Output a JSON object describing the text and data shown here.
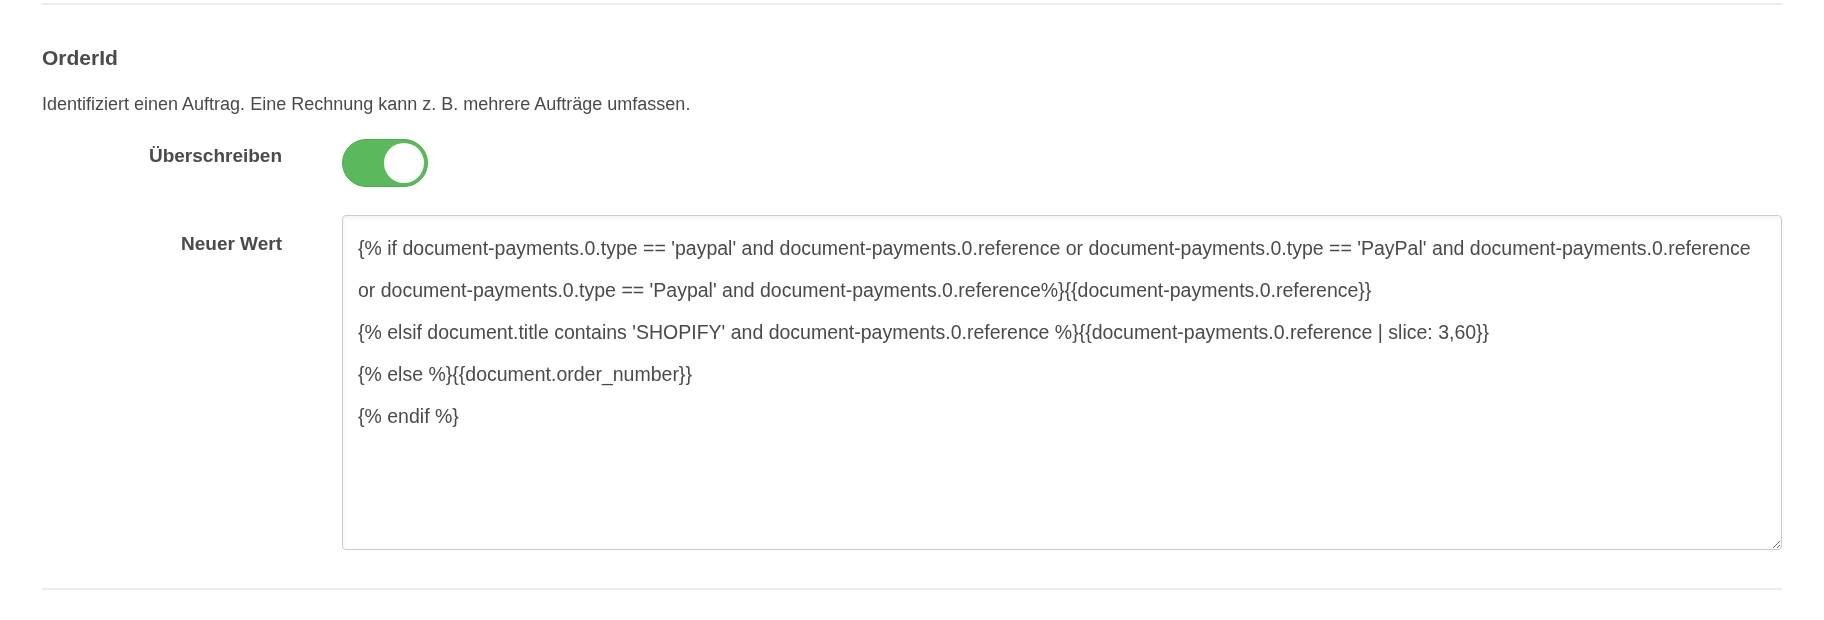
{
  "section": {
    "title": "OrderId",
    "description": "Identifiziert einen Auftrag. Eine Rechnung kann z. B. mehrere Aufträge umfassen."
  },
  "fields": [
    {
      "kind": "toggle",
      "label": "Überschreiben",
      "on": true
    },
    {
      "kind": "textarea",
      "label": "Neuer Wert",
      "value": "{% if document-payments.0.type == 'paypal' and document-payments.0.reference or document-payments.0.type == 'PayPal' and document-payments.0.reference or document-payments.0.type == 'Paypal' and document-payments.0.reference%}{{document-payments.0.reference}}\n{% elsif document.title contains 'SHOPIFY' and document-payments.0.reference %}{{document-payments.0.reference | slice: 3,60}}\n{% else %}{{document.order_number}}\n{% endif %}"
    }
  ]
}
